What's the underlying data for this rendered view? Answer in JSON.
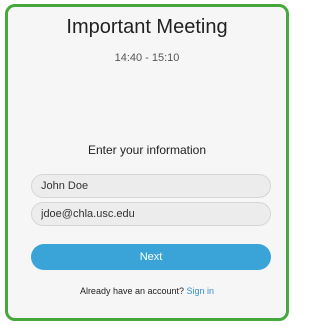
{
  "meeting": {
    "title": "Important Meeting",
    "time": "14:40 - 15:10"
  },
  "form": {
    "prompt": "Enter your information",
    "name_value": "John Doe",
    "email_value": "jdoe@chla.usc.edu",
    "next_label": "Next"
  },
  "footer": {
    "account_text": "Already have an account?",
    "signin_label": "Sign in"
  },
  "colors": {
    "border": "#46a83c",
    "button": "#3aa4d9",
    "link": "#3a8fd0"
  }
}
